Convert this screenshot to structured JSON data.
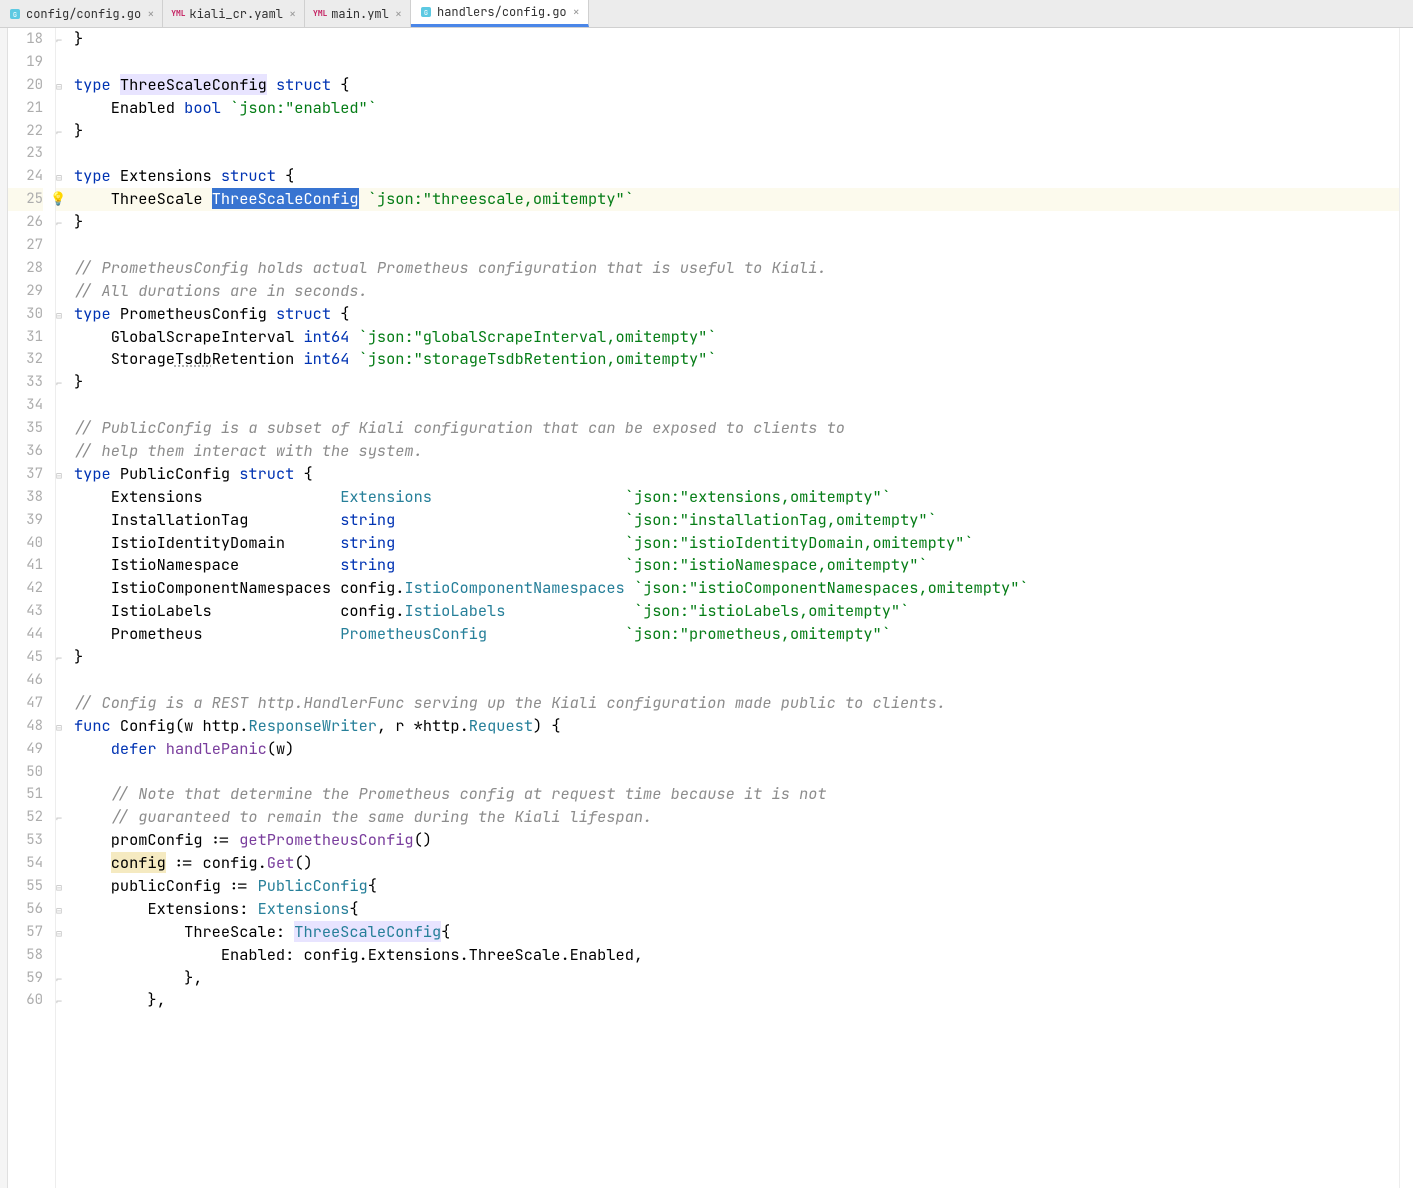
{
  "tabs": [
    {
      "label": "config/config.go",
      "iconType": "go",
      "active": false
    },
    {
      "label": "kiali_cr.yaml",
      "iconType": "yml",
      "active": false
    },
    {
      "label": "main.yml",
      "iconType": "yml",
      "active": false
    },
    {
      "label": "handlers/config.go",
      "iconType": "go",
      "active": true
    }
  ],
  "startLine": 18,
  "endLine": 60,
  "highlightedLine": 25,
  "bulbLine": 25,
  "code": {
    "l18": "}",
    "l19": "",
    "l20": {
      "pre": "type ",
      "name": "ThreeScaleConfig",
      "mid": " struct {",
      "nameHl": true
    },
    "l21": {
      "indent": "    ",
      "field": "Enabled ",
      "type": "bool",
      "tag": " `json:\"enabled\"`"
    },
    "l22": "}",
    "l23": "",
    "l24": {
      "pre": "type ",
      "name": "Extensions",
      "mid": " struct {"
    },
    "l25": {
      "indent": "    ",
      "field": "ThreeScale ",
      "typeSel": "ThreeScaleConfig",
      "tag": " `json:\"threescale,omitempty\"`"
    },
    "l26": "}",
    "l27": "",
    "l28": "// PrometheusConfig holds actual Prometheus configuration that is useful to Kiali.",
    "l29": "// All durations are in seconds.",
    "l30": {
      "pre": "type ",
      "name": "PrometheusConfig",
      "mid": " struct {"
    },
    "l31": {
      "indent": "    ",
      "field": "GlobalScrapeInterval ",
      "type": "int64",
      "tag": " `json:\"globalScrapeInterval,omitempty\"`"
    },
    "l32": {
      "indent": "    ",
      "field": "StorageTsdbRetention ",
      "type": "int64",
      "tag": " `json:\"storageTsdbRetention,omitempty\"`"
    },
    "l33": "}",
    "l34": "",
    "l35": "// PublicConfig is a subset of Kiali configuration that can be exposed to clients to",
    "l36": "// help them interact with the system.",
    "l37": {
      "pre": "type ",
      "name": "PublicConfig",
      "mid": " struct {"
    },
    "l38": {
      "indent": "    ",
      "field": "Extensions               ",
      "type": "Extensions                     ",
      "typeLink": true,
      "tag": "`json:\"extensions,omitempty\"`"
    },
    "l39": {
      "indent": "    ",
      "field": "InstallationTag          ",
      "type": "string                         ",
      "tag": "`json:\"installationTag,omitempty\"`"
    },
    "l40": {
      "indent": "    ",
      "field": "IstioIdentityDomain      ",
      "type": "string                         ",
      "tag": "`json:\"istioIdentityDomain,omitempty\"`"
    },
    "l41": {
      "indent": "    ",
      "field": "IstioNamespace           ",
      "type": "string                         ",
      "tag": "`json:\"istioNamespace,omitempty\"`"
    },
    "l42": {
      "indent": "    ",
      "field": "IstioComponentNamespaces ",
      "pkg": "config.",
      "type": "IstioComponentNamespaces ",
      "typeLink": true,
      "tag": "`json:\"istioComponentNamespaces,omitempty\"`"
    },
    "l43": {
      "indent": "    ",
      "field": "IstioLabels              ",
      "pkg": "config.",
      "type": "IstioLabels              ",
      "typeLink": true,
      "tag": "`json:\"istioLabels,omitempty\"`"
    },
    "l44": {
      "indent": "    ",
      "field": "Prometheus               ",
      "type": "PrometheusConfig               ",
      "typeLink": true,
      "tag": "`json:\"prometheus,omitempty\"`"
    },
    "l45": "}",
    "l46": "",
    "l47": "// Config is a REST http.HandlerFunc serving up the Kiali configuration made public to clients.",
    "l48_raw": "func Config(w http.ResponseWriter, r *http.Request) {",
    "l49_raw": "    defer handlePanic(w)",
    "l50": "",
    "l51": "    // Note that determine the Prometheus config at request time because it is not",
    "l52": "    // guaranteed to remain the same during the Kiali lifespan.",
    "l53_raw": "    promConfig := getPrometheusConfig()",
    "l54_raw": "    config := config.Get()",
    "l55_raw": "    publicConfig := PublicConfig{",
    "l56_raw": "        Extensions: Extensions{",
    "l57_raw": "            ThreeScale: ThreeScaleConfig{",
    "l58_raw": "                Enabled: config.Extensions.ThreeScale.Enabled,",
    "l59_raw": "            },",
    "l60_raw": "        },"
  }
}
